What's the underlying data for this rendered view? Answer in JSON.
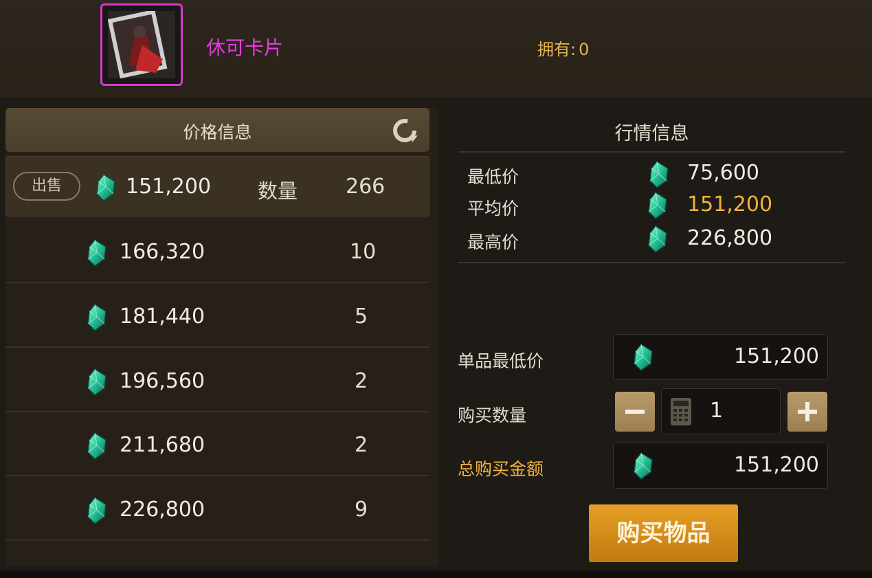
{
  "item": {
    "name": "休可卡片",
    "owned_label": "拥有:",
    "owned_value": "0"
  },
  "price_panel": {
    "title": "价格信息",
    "sell_label": "出售",
    "qty_label": "数量",
    "rows": [
      {
        "price": "151,200",
        "qty": "266"
      },
      {
        "price": "166,320",
        "qty": "10"
      },
      {
        "price": "181,440",
        "qty": "5"
      },
      {
        "price": "196,560",
        "qty": "2"
      },
      {
        "price": "211,680",
        "qty": "2"
      },
      {
        "price": "226,800",
        "qty": "9"
      }
    ]
  },
  "market_panel": {
    "title": "行情信息",
    "min_label": "最低价",
    "min_value": "75,600",
    "avg_label": "平均价",
    "avg_value": "151,200",
    "max_label": "最高价",
    "max_value": "226,800"
  },
  "purchase": {
    "unit_min_label": "单品最低价",
    "unit_min_value": "151,200",
    "qty_label": "购买数量",
    "qty_value": "1",
    "total_label": "总购买金额",
    "total_value": "151,200",
    "buy_button": "购买物品"
  },
  "icons": {
    "currency": "gem-icon",
    "refresh": "refresh-icon",
    "calculator": "calculator-icon"
  },
  "colors": {
    "item_name": "#e23de0",
    "accent_gold": "#f0b43c",
    "buy_button": "#d98f1a"
  }
}
